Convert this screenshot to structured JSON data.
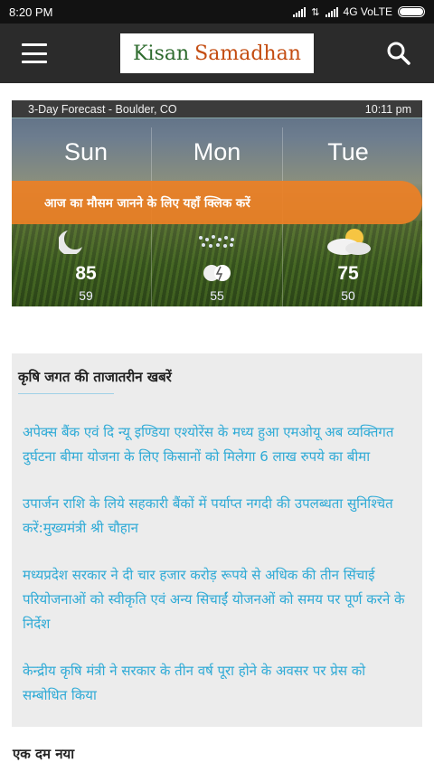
{
  "status_bar": {
    "time": "8:20 PM",
    "network": "4G VoLTE"
  },
  "app_bar": {
    "logo_word1": "Kisan",
    "logo_word2": "Samadhan",
    "menu_icon": "hamburger-menu-icon",
    "search_icon": "search-icon",
    "colors": {
      "bar": "#2b2b2b",
      "logo_green": "#2e6b2e",
      "logo_orange": "#c44d12"
    }
  },
  "weather": {
    "header": "3-Day Forecast - Boulder, CO",
    "time": "10:11 pm",
    "cta": "आज का मौसम जानने के लिए यहाँ क्लिक करें",
    "cta_color": "#ec8026",
    "days": [
      {
        "day": "Sun",
        "high": "85",
        "low": "59",
        "icon": "moon-cloud-icon"
      },
      {
        "day": "Mon",
        "high": "",
        "low": "55",
        "icon": "thunderstorm-icon"
      },
      {
        "day": "Tue",
        "high": "75",
        "low": "50",
        "icon": "partly-cloudy-icon"
      }
    ]
  },
  "news": {
    "title": "कृषि जगत की ताजातरीन खबरें",
    "link_color": "#2eaad6",
    "items": [
      "अपेक्स बैंक एवं दि न्यू इण्डिया एश्योरेंस के मध्य हुआ एमओयू अब व्यक्तिगत दुर्घटना बीमा योजना के लिए किसानों को मिलेगा 6 लाख रुपये का बीमा",
      "उपार्जन राशि के लिये सहकारी बैंकों में पर्याप्त नगदी की उपलब्धता सुनिश्चित करें:मुख्यमंत्री श्री चौहान",
      "मध्यप्रदेश सरकार ने दी चार हजार करोड़ रूपये से अधिक की तीन सिंचाई परियोजनाओं को स्वीकृति एवं अन्य सिचाईं योजनओं को समय पर पूर्ण करने के निर्देश",
      "केन्द्रीय कृषि मंत्री ने सरकार के तीन वर्ष पूरा होने के अवसर पर प्रेस को सम्बोधित किया"
    ]
  },
  "section_new": {
    "title": "एक दम नया"
  }
}
